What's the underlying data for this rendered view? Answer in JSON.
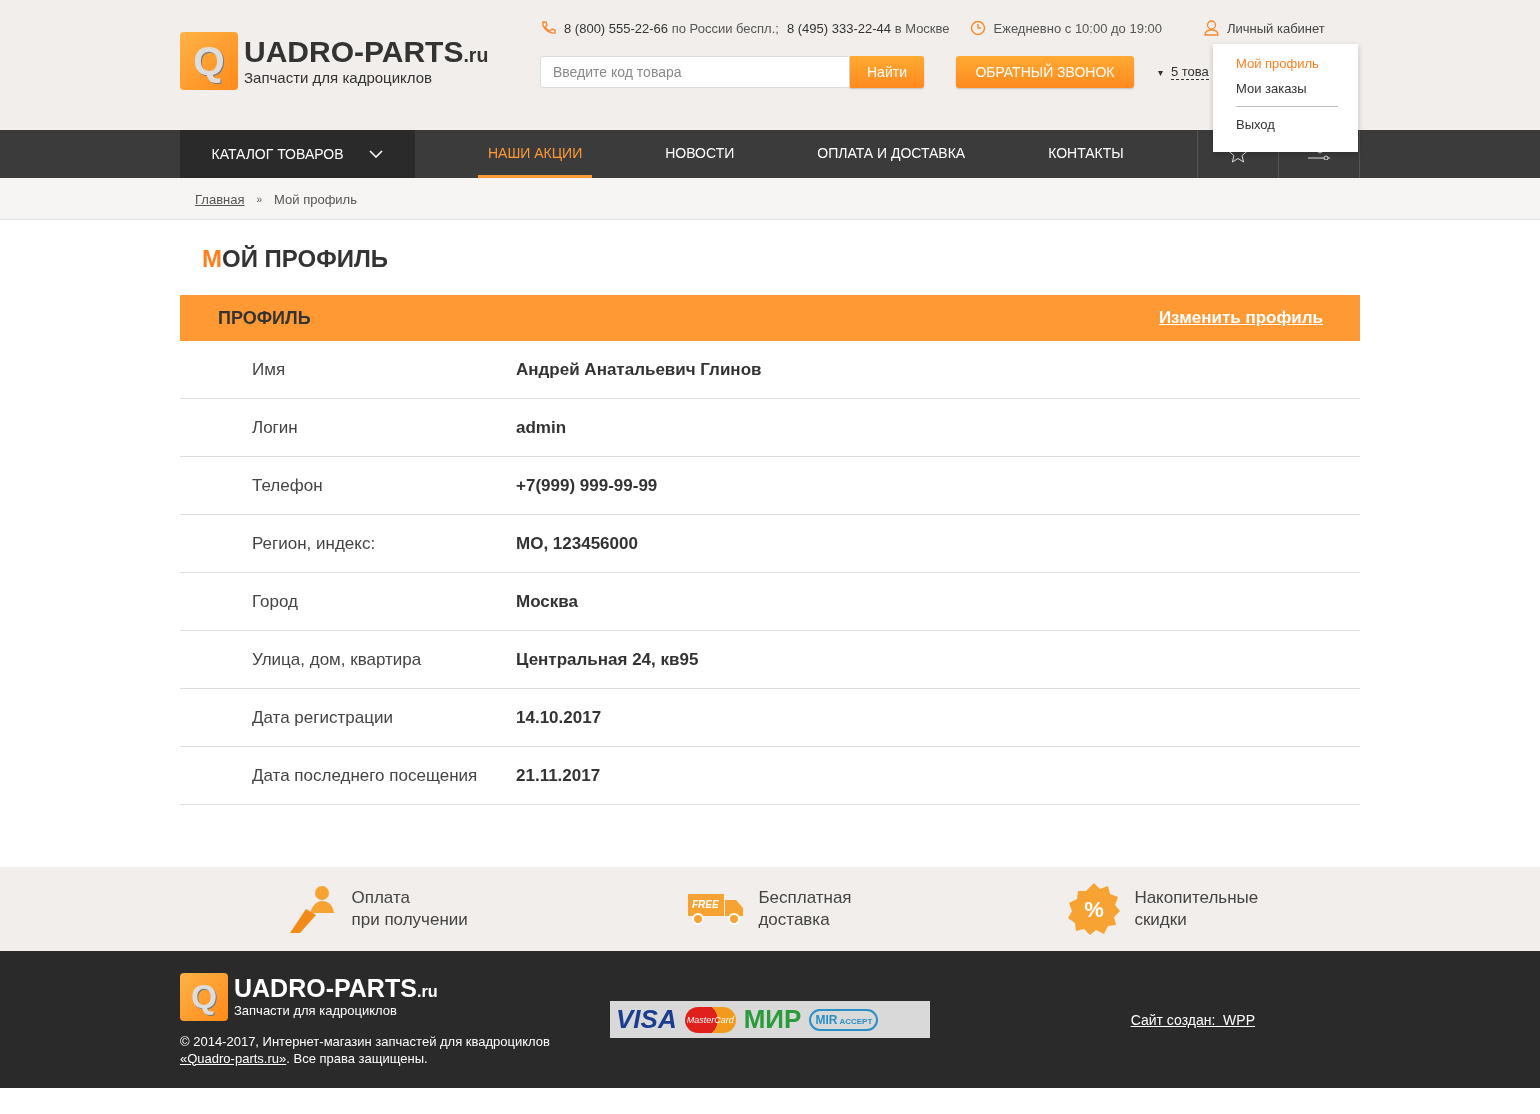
{
  "logo": {
    "letter": "Q",
    "name": "UADRO-PARTS",
    "domain": ".ru",
    "tagline": "Запчасти для кадроциклов"
  },
  "contacts": {
    "phone1": "8 (800) 555-22-66",
    "phone1_note": "по России беспл.;",
    "phone2": "8 (495) 333-22-44",
    "phone2_note": "в Москве",
    "hours": "Ежедневно с 10:00 до 19:00",
    "account": "Личный кабинет"
  },
  "search": {
    "placeholder": "Введите код товара",
    "button": "Найти"
  },
  "callback_button": "ОБРАТНЫЙ ЗВОНОК",
  "cart": {
    "caret": "▾",
    "text": "5 това"
  },
  "account_menu": {
    "items": [
      {
        "label": "Мой профиль",
        "selected": true
      },
      {
        "label": "Мои заказы",
        "selected": false
      },
      {
        "label": "Выход",
        "selected": false
      }
    ]
  },
  "catalog_button": "КАТАЛОГ ТОВАРОВ",
  "nav": [
    {
      "label": "НАШИ АКЦИИ",
      "selected": true
    },
    {
      "label": "НОВОСТИ",
      "selected": false
    },
    {
      "label": "ОПЛАТА И ДОСТАВКА",
      "selected": false
    },
    {
      "label": "КОНТАКТЫ",
      "selected": false
    }
  ],
  "breadcrumbs": {
    "home": "Главная",
    "separator": "»",
    "current": "Мой профиль"
  },
  "page_title": "МОЙ ПРОФИЛЬ",
  "profile": {
    "header": "ПРОФИЛЬ",
    "edit_link": "Изменить профиль",
    "rows": [
      {
        "label": "Имя",
        "value": "Андрей Анатальевич Глинов"
      },
      {
        "label": "Логин",
        "value": "admin"
      },
      {
        "label": "Телефон",
        "value": "+7(999) 999-99-99"
      },
      {
        "label": "Регион, индекс:",
        "value": "МО, 123456000"
      },
      {
        "label": "Город",
        "value": "Москва"
      },
      {
        "label": "Улица, дом, квартира",
        "value": "Центральная 24, кв95"
      },
      {
        "label": "Дата регистрации",
        "value": "14.10.2017"
      },
      {
        "label": "Дата последнего посещения",
        "value": "21.11.2017"
      }
    ]
  },
  "features": [
    {
      "kind": "payment",
      "line1": "Оплата",
      "line2": "при получении"
    },
    {
      "kind": "delivery",
      "badge": "FREE",
      "line1": "Бесплатная",
      "line2": "доставка"
    },
    {
      "kind": "discount",
      "badge": "%",
      "line1": "Накопительные",
      "line2": "скидки"
    }
  ],
  "footer": {
    "logo": {
      "letter": "Q",
      "name": "UADRO-PARTS",
      "domain": ".ru",
      "tagline": "Запчасти для кадроциклов"
    },
    "copyright": "© 2014-2017, Интернет-магазин запчастей для квадроциклов",
    "site_link": "«Quadro-parts.ru»",
    "rights": ". Все права защищены.",
    "payments": [
      "VISA",
      "MasterCard",
      "МИР",
      "MIR",
      "ACCEPT"
    ],
    "credit": "Сайт создан:  WPP"
  }
}
